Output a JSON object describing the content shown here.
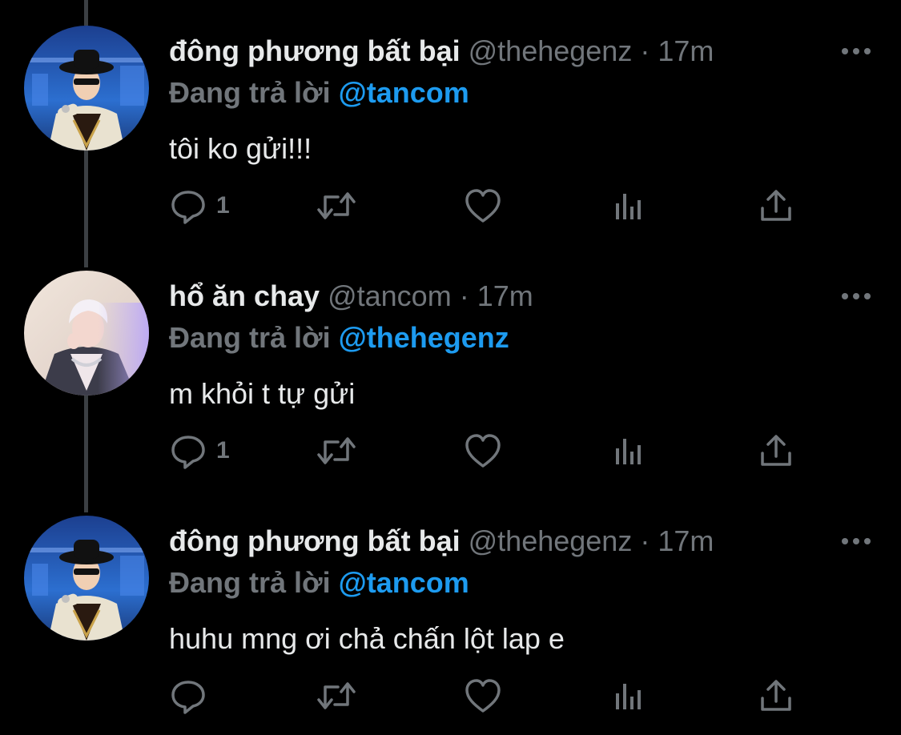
{
  "tweets": [
    {
      "name": "đông phương bất bại",
      "handle": "@thehegenz",
      "separator": "·",
      "time": "17m",
      "replying_prefix": "Đang trả lời",
      "replying_to": "@tancom",
      "text": "tôi ko gửi!!!",
      "reply_count": "1",
      "avatar": "avatar-hat-performer"
    },
    {
      "name": "hổ ăn chay",
      "handle": "@tancom",
      "separator": "·",
      "time": "17m",
      "replying_prefix": "Đang trả lời",
      "replying_to": "@thehegenz",
      "text": "m khỏi t tự gửi",
      "reply_count": "1",
      "avatar": "avatar-blonde-performer"
    },
    {
      "name": "đông phương bất bại",
      "handle": "@thehegenz",
      "separator": "·",
      "time": "17m",
      "replying_prefix": "Đang trả lời",
      "replying_to": "@tancom",
      "text": "huhu mng ơi chả chấn lột lap e",
      "reply_count": "",
      "avatar": "avatar-hat-performer"
    }
  ],
  "icons": {
    "more": "more-icon",
    "reply": "reply-icon",
    "retweet": "retweet-icon",
    "like": "heart-icon",
    "views": "views-icon",
    "share": "share-icon"
  },
  "colors": {
    "background": "#000000",
    "text": "#e7e9ea",
    "muted": "#71767b",
    "accent": "#1d9bf0",
    "thread_line": "#3b3f43"
  }
}
